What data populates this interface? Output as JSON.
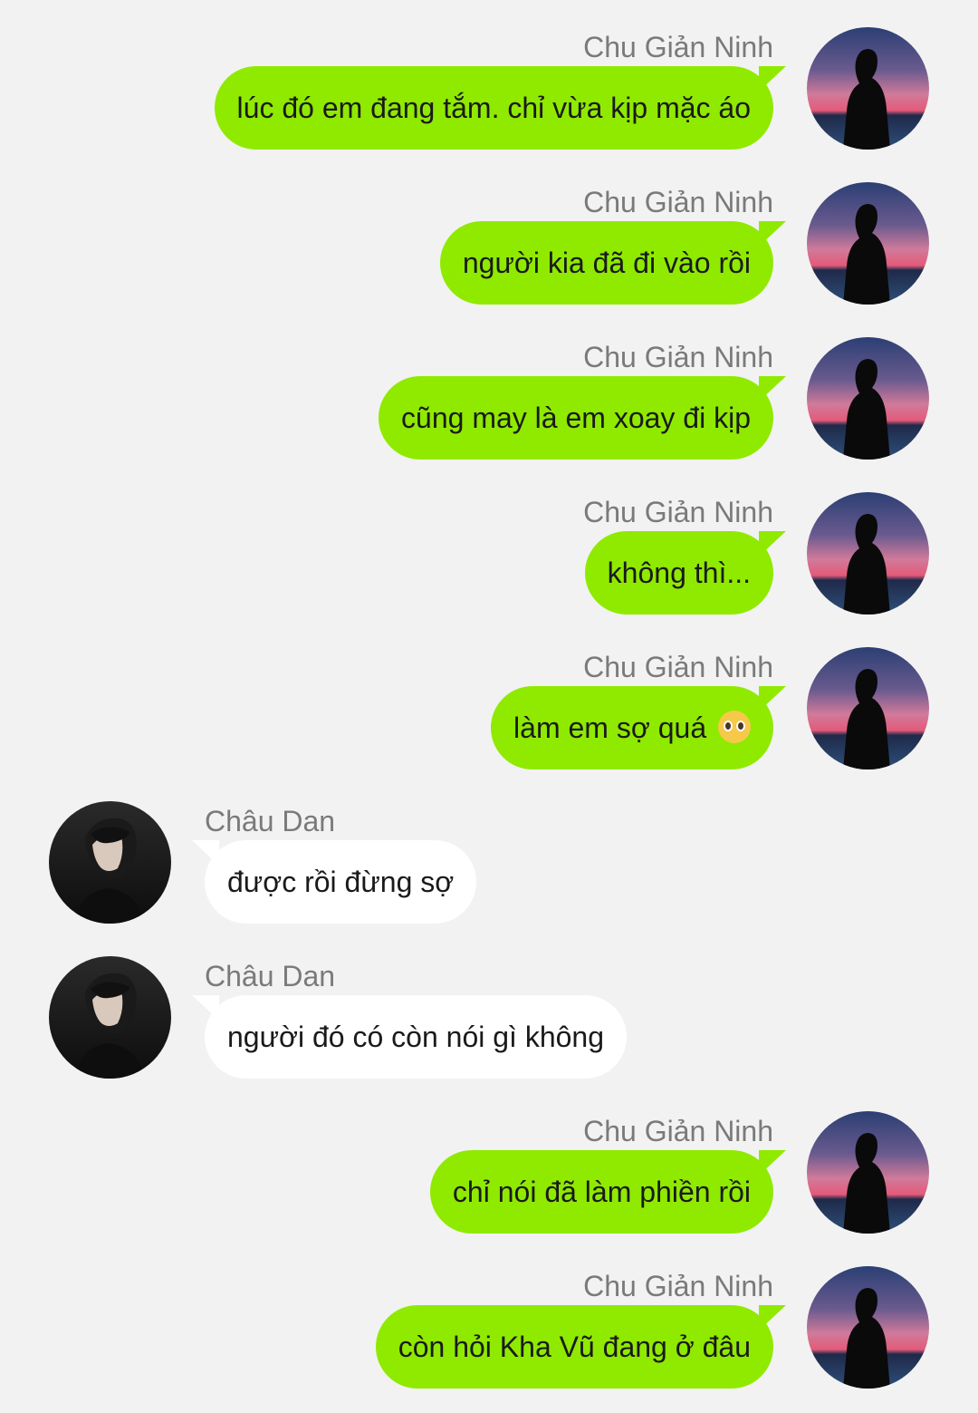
{
  "conversation": {
    "participants": {
      "me": {
        "name": "Chu Giản Ninh",
        "bubble_color": "#8fea00"
      },
      "other": {
        "name": "Châu Dan",
        "bubble_color": "#ffffff"
      }
    },
    "messages": [
      {
        "sender": "Chu Giản Ninh",
        "side": "right",
        "text": "lúc đó em đang tắm. chỉ vừa kịp mặc áo"
      },
      {
        "sender": "Chu Giản Ninh",
        "side": "right",
        "text": "người kia đã đi vào rồi"
      },
      {
        "sender": "Chu Giản Ninh",
        "side": "right",
        "text": "cũng may là em xoay đi kịp"
      },
      {
        "sender": "Chu Giản Ninh",
        "side": "right",
        "text": "không thì..."
      },
      {
        "sender": "Chu Giản Ninh",
        "side": "right",
        "text": "làm em sợ quá",
        "emoji": "pleading-face-icon"
      },
      {
        "sender": "Châu Dan",
        "side": "left",
        "text": "được rồi đừng sợ"
      },
      {
        "sender": "Châu Dan",
        "side": "left",
        "text": "người đó có còn nói gì không"
      },
      {
        "sender": "Chu Giản Ninh",
        "side": "right",
        "text": "chỉ nói đã làm phiền rồi"
      },
      {
        "sender": "Chu Giản Ninh",
        "side": "right",
        "text": "còn hỏi Kha Vũ đang ở đâu"
      }
    ]
  },
  "colors": {
    "background": "#f2f2f2",
    "sender_name": "#7a7a7a",
    "my_bubble": "#8fea00",
    "other_bubble": "#ffffff"
  }
}
